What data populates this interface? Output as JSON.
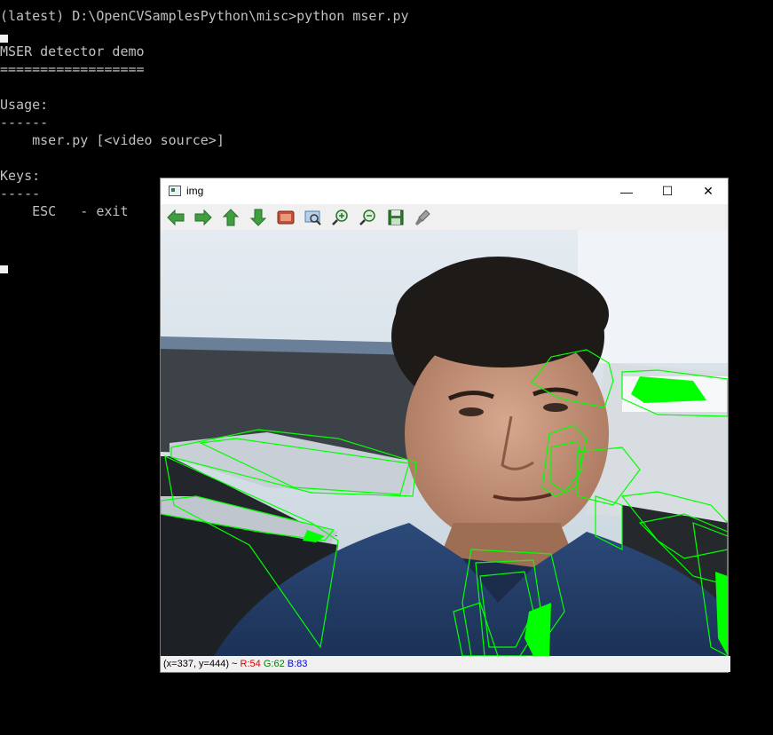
{
  "console": {
    "lines": [
      "(latest) D:\\OpenCVSamplesPython\\misc>python mser.py",
      "",
      "MSER detector demo",
      "==================",
      "",
      "Usage:",
      "------",
      "    mser.py [<video source>]",
      "",
      "Keys:",
      "-----",
      "    ESC   - exit"
    ]
  },
  "window": {
    "title": "img",
    "controls": {
      "minimize": "—",
      "maximize": "☐",
      "close": "✕"
    },
    "toolbar": [
      {
        "name": "pan-left-icon",
        "color": "#3f9e3f"
      },
      {
        "name": "pan-right-icon",
        "color": "#3f9e3f"
      },
      {
        "name": "pan-up-icon",
        "color": "#3f9e3f"
      },
      {
        "name": "pan-down-icon",
        "color": "#3f9e3f"
      },
      {
        "name": "zoom-fit-icon",
        "color": "#c0503a"
      },
      {
        "name": "zoom-original-icon",
        "color": "#4a7fb0"
      },
      {
        "name": "zoom-in-icon",
        "color": "#2e6e2e"
      },
      {
        "name": "zoom-out-icon",
        "color": "#2e6e2e"
      },
      {
        "name": "save-icon",
        "color": "#2e7d2e"
      },
      {
        "name": "properties-icon",
        "color": "#808080"
      }
    ]
  },
  "status": {
    "coords": "(x=337, y=444) ~ ",
    "r": "R:54",
    "g": "G:62",
    "b": "B:83",
    "r_color": "#e00000",
    "g_color": "#008000",
    "b_color": "#0000e0"
  },
  "overlay": {
    "contour_color": "#00ff00"
  }
}
